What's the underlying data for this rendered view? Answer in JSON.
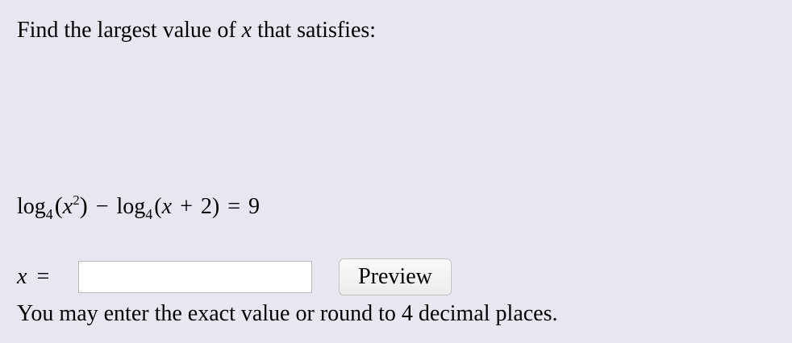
{
  "prompt": {
    "before": "Find the largest value of ",
    "variable": "x",
    "after": " that satisfies:"
  },
  "equation": {
    "log1": "log",
    "base1": "4",
    "open_paren1": "(",
    "arg1_var": "x",
    "arg1_exp": "2",
    "close_paren1": ")",
    "minus": "−",
    "log2": "log",
    "base2": "4",
    "open_paren2": "(",
    "arg2_var": "x",
    "plus": "+",
    "arg2_const": "2",
    "close_paren2": ")",
    "equals": "=",
    "rhs": "9"
  },
  "answer": {
    "variable": "x",
    "equals": "=",
    "input_value": "",
    "preview_label": "Preview"
  },
  "hint": "You may enter the exact value or round to 4 decimal places."
}
